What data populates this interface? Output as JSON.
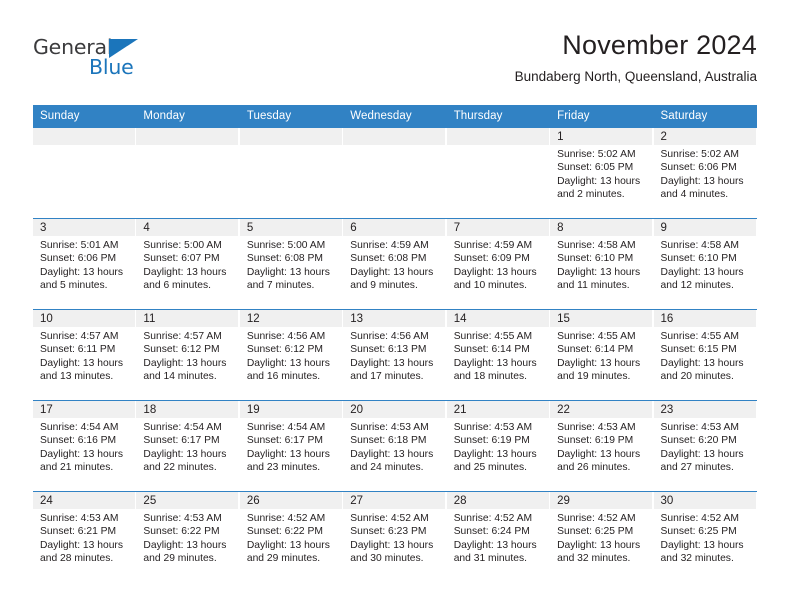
{
  "brand": {
    "name_part1": "General",
    "name_part2": "Blue",
    "accent_color": "#1b75bb"
  },
  "header": {
    "title": "November 2024",
    "location": "Bundaberg North, Queensland, Australia"
  },
  "theme": {
    "header_blue": "#3182c4",
    "daynum_strip": "#f0f0f0",
    "text": "#231f20"
  },
  "weekday_headers": [
    "Sunday",
    "Monday",
    "Tuesday",
    "Wednesday",
    "Thursday",
    "Friday",
    "Saturday"
  ],
  "labels": {
    "sunrise": "Sunrise:",
    "sunset": "Sunset:",
    "daylight": "Daylight:"
  },
  "weeks": [
    {
      "days": [
        {
          "num": "",
          "empty": true,
          "sunrise": "",
          "sunset": "",
          "daylight": ""
        },
        {
          "num": "",
          "empty": true,
          "sunrise": "",
          "sunset": "",
          "daylight": ""
        },
        {
          "num": "",
          "empty": true,
          "sunrise": "",
          "sunset": "",
          "daylight": ""
        },
        {
          "num": "",
          "empty": true,
          "sunrise": "",
          "sunset": "",
          "daylight": ""
        },
        {
          "num": "",
          "empty": true,
          "sunrise": "",
          "sunset": "",
          "daylight": ""
        },
        {
          "num": "1",
          "empty": false,
          "sunrise": "Sunrise: 5:02 AM",
          "sunset": "Sunset: 6:05 PM",
          "daylight": "Daylight: 13 hours and 2 minutes."
        },
        {
          "num": "2",
          "empty": false,
          "sunrise": "Sunrise: 5:02 AM",
          "sunset": "Sunset: 6:06 PM",
          "daylight": "Daylight: 13 hours and 4 minutes."
        }
      ]
    },
    {
      "days": [
        {
          "num": "3",
          "empty": false,
          "sunrise": "Sunrise: 5:01 AM",
          "sunset": "Sunset: 6:06 PM",
          "daylight": "Daylight: 13 hours and 5 minutes."
        },
        {
          "num": "4",
          "empty": false,
          "sunrise": "Sunrise: 5:00 AM",
          "sunset": "Sunset: 6:07 PM",
          "daylight": "Daylight: 13 hours and 6 minutes."
        },
        {
          "num": "5",
          "empty": false,
          "sunrise": "Sunrise: 5:00 AM",
          "sunset": "Sunset: 6:08 PM",
          "daylight": "Daylight: 13 hours and 7 minutes."
        },
        {
          "num": "6",
          "empty": false,
          "sunrise": "Sunrise: 4:59 AM",
          "sunset": "Sunset: 6:08 PM",
          "daylight": "Daylight: 13 hours and 9 minutes."
        },
        {
          "num": "7",
          "empty": false,
          "sunrise": "Sunrise: 4:59 AM",
          "sunset": "Sunset: 6:09 PM",
          "daylight": "Daylight: 13 hours and 10 minutes."
        },
        {
          "num": "8",
          "empty": false,
          "sunrise": "Sunrise: 4:58 AM",
          "sunset": "Sunset: 6:10 PM",
          "daylight": "Daylight: 13 hours and 11 minutes."
        },
        {
          "num": "9",
          "empty": false,
          "sunrise": "Sunrise: 4:58 AM",
          "sunset": "Sunset: 6:10 PM",
          "daylight": "Daylight: 13 hours and 12 minutes."
        }
      ]
    },
    {
      "days": [
        {
          "num": "10",
          "empty": false,
          "sunrise": "Sunrise: 4:57 AM",
          "sunset": "Sunset: 6:11 PM",
          "daylight": "Daylight: 13 hours and 13 minutes."
        },
        {
          "num": "11",
          "empty": false,
          "sunrise": "Sunrise: 4:57 AM",
          "sunset": "Sunset: 6:12 PM",
          "daylight": "Daylight: 13 hours and 14 minutes."
        },
        {
          "num": "12",
          "empty": false,
          "sunrise": "Sunrise: 4:56 AM",
          "sunset": "Sunset: 6:12 PM",
          "daylight": "Daylight: 13 hours and 16 minutes."
        },
        {
          "num": "13",
          "empty": false,
          "sunrise": "Sunrise: 4:56 AM",
          "sunset": "Sunset: 6:13 PM",
          "daylight": "Daylight: 13 hours and 17 minutes."
        },
        {
          "num": "14",
          "empty": false,
          "sunrise": "Sunrise: 4:55 AM",
          "sunset": "Sunset: 6:14 PM",
          "daylight": "Daylight: 13 hours and 18 minutes."
        },
        {
          "num": "15",
          "empty": false,
          "sunrise": "Sunrise: 4:55 AM",
          "sunset": "Sunset: 6:14 PM",
          "daylight": "Daylight: 13 hours and 19 minutes."
        },
        {
          "num": "16",
          "empty": false,
          "sunrise": "Sunrise: 4:55 AM",
          "sunset": "Sunset: 6:15 PM",
          "daylight": "Daylight: 13 hours and 20 minutes."
        }
      ]
    },
    {
      "days": [
        {
          "num": "17",
          "empty": false,
          "sunrise": "Sunrise: 4:54 AM",
          "sunset": "Sunset: 6:16 PM",
          "daylight": "Daylight: 13 hours and 21 minutes."
        },
        {
          "num": "18",
          "empty": false,
          "sunrise": "Sunrise: 4:54 AM",
          "sunset": "Sunset: 6:17 PM",
          "daylight": "Daylight: 13 hours and 22 minutes."
        },
        {
          "num": "19",
          "empty": false,
          "sunrise": "Sunrise: 4:54 AM",
          "sunset": "Sunset: 6:17 PM",
          "daylight": "Daylight: 13 hours and 23 minutes."
        },
        {
          "num": "20",
          "empty": false,
          "sunrise": "Sunrise: 4:53 AM",
          "sunset": "Sunset: 6:18 PM",
          "daylight": "Daylight: 13 hours and 24 minutes."
        },
        {
          "num": "21",
          "empty": false,
          "sunrise": "Sunrise: 4:53 AM",
          "sunset": "Sunset: 6:19 PM",
          "daylight": "Daylight: 13 hours and 25 minutes."
        },
        {
          "num": "22",
          "empty": false,
          "sunrise": "Sunrise: 4:53 AM",
          "sunset": "Sunset: 6:19 PM",
          "daylight": "Daylight: 13 hours and 26 minutes."
        },
        {
          "num": "23",
          "empty": false,
          "sunrise": "Sunrise: 4:53 AM",
          "sunset": "Sunset: 6:20 PM",
          "daylight": "Daylight: 13 hours and 27 minutes."
        }
      ]
    },
    {
      "days": [
        {
          "num": "24",
          "empty": false,
          "sunrise": "Sunrise: 4:53 AM",
          "sunset": "Sunset: 6:21 PM",
          "daylight": "Daylight: 13 hours and 28 minutes."
        },
        {
          "num": "25",
          "empty": false,
          "sunrise": "Sunrise: 4:53 AM",
          "sunset": "Sunset: 6:22 PM",
          "daylight": "Daylight: 13 hours and 29 minutes."
        },
        {
          "num": "26",
          "empty": false,
          "sunrise": "Sunrise: 4:52 AM",
          "sunset": "Sunset: 6:22 PM",
          "daylight": "Daylight: 13 hours and 29 minutes."
        },
        {
          "num": "27",
          "empty": false,
          "sunrise": "Sunrise: 4:52 AM",
          "sunset": "Sunset: 6:23 PM",
          "daylight": "Daylight: 13 hours and 30 minutes."
        },
        {
          "num": "28",
          "empty": false,
          "sunrise": "Sunrise: 4:52 AM",
          "sunset": "Sunset: 6:24 PM",
          "daylight": "Daylight: 13 hours and 31 minutes."
        },
        {
          "num": "29",
          "empty": false,
          "sunrise": "Sunrise: 4:52 AM",
          "sunset": "Sunset: 6:25 PM",
          "daylight": "Daylight: 13 hours and 32 minutes."
        },
        {
          "num": "30",
          "empty": false,
          "sunrise": "Sunrise: 4:52 AM",
          "sunset": "Sunset: 6:25 PM",
          "daylight": "Daylight: 13 hours and 32 minutes."
        }
      ]
    }
  ]
}
